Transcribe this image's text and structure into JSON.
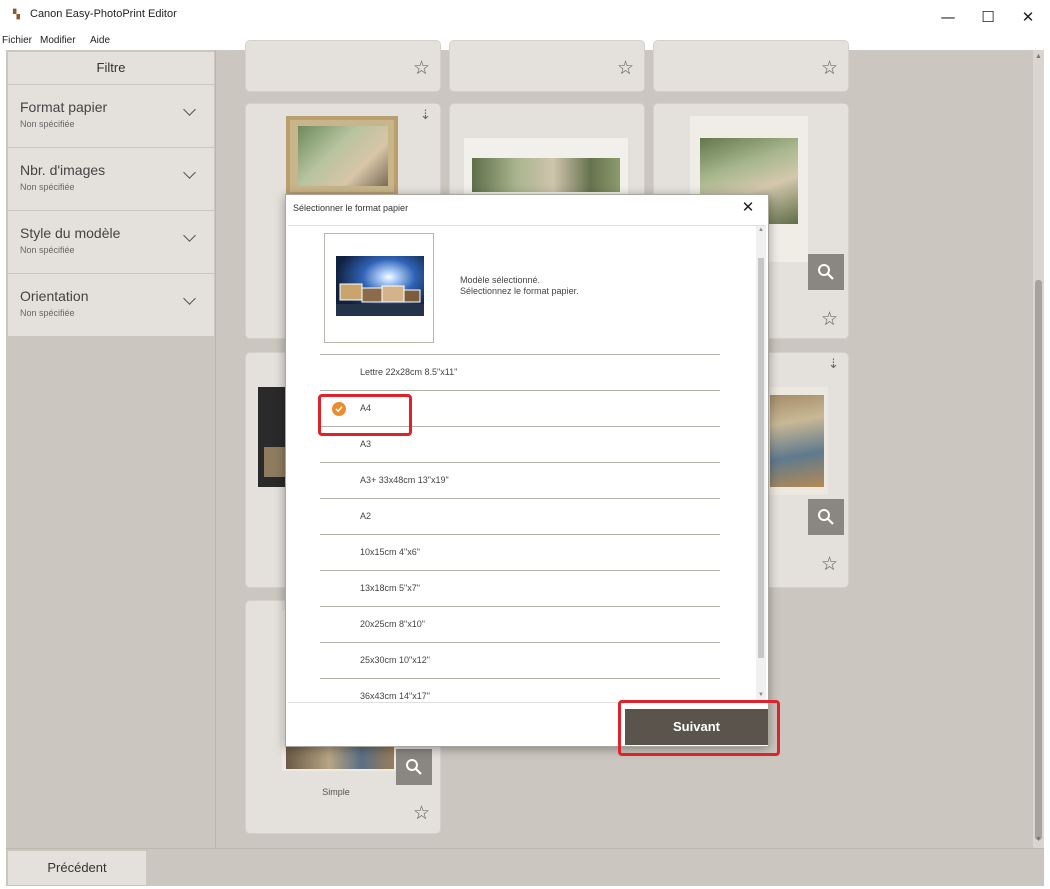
{
  "window": {
    "title": "Canon Easy-PhotoPrint Editor",
    "app_icon": "app-logo-icon",
    "minimize_glyph": "—",
    "maximize_glyph": "☐",
    "close_glyph": "✕"
  },
  "menu": {
    "items": [
      {
        "label": "Fichier"
      },
      {
        "label": "Modifier"
      },
      {
        "label": "Aide"
      }
    ]
  },
  "sidebar": {
    "header": "Filtre",
    "filters": [
      {
        "label": "Format papier",
        "value": "Non spécifiée"
      },
      {
        "label": "Nbr. d'images",
        "value": "Non spécifiée"
      },
      {
        "label": "Style du modèle",
        "value": "Non spécifiée"
      },
      {
        "label": "Orientation",
        "value": "Non spécifiée"
      }
    ]
  },
  "gallery": {
    "card_labels": [
      "Simple"
    ],
    "icons": {
      "favorite": "star-icon",
      "download": "cloud-download-icon",
      "zoom": "search-icon"
    }
  },
  "footer": {
    "previous_label": "Précédent"
  },
  "dialog": {
    "title": "Sélectionner le format papier",
    "close_glyph": "✕",
    "message_line1": "Modèle sélectionné.",
    "message_line2": "Sélectionnez le format papier.",
    "paper_sizes": [
      {
        "label": "Lettre 22x28cm 8.5\"x11\"",
        "selected": false
      },
      {
        "label": "A4",
        "selected": true
      },
      {
        "label": "A3",
        "selected": false
      },
      {
        "label": "A3+ 33x48cm 13\"x19\"",
        "selected": false
      },
      {
        "label": "A2",
        "selected": false
      },
      {
        "label": "10x15cm 4\"x6\"",
        "selected": false
      },
      {
        "label": "13x18cm 5\"x7\"",
        "selected": false
      },
      {
        "label": "20x25cm 8\"x10\"",
        "selected": false
      },
      {
        "label": "25x30cm 10\"x12\"",
        "selected": false
      },
      {
        "label": "36x43cm 14\"x17\"",
        "selected": false
      }
    ],
    "next_label": "Suivant"
  },
  "colors": {
    "accent": "#ed8b2d",
    "highlight": "#e0222a",
    "primary_button": "#5a544d",
    "panel": "#e4e1dc",
    "background": "#cbc7c0"
  }
}
